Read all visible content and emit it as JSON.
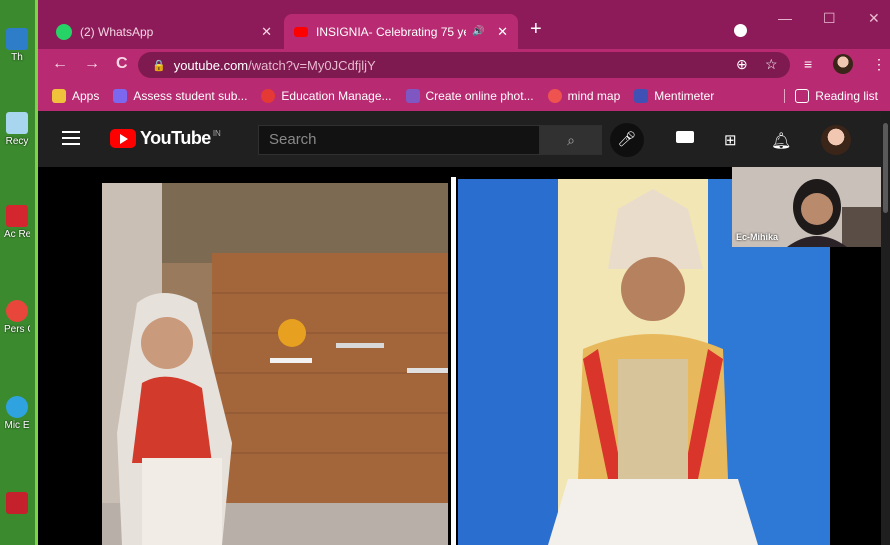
{
  "desktop": {
    "icons": [
      {
        "label": "Th",
        "name": "this-pc-icon",
        "color": "#2e7dc8"
      },
      {
        "label": "Recy",
        "name": "recycle-bin-icon",
        "color": "#a8d6ee"
      },
      {
        "label": "Ac Rea",
        "name": "acrobat-reader-icon",
        "color": "#d3262e"
      },
      {
        "label": "Pers Ch",
        "name": "chrome-person-icon",
        "color": "#e8463a"
      },
      {
        "label": "Mic E",
        "name": "microsoft-edge-icon",
        "color": "#2fa3e0"
      },
      {
        "label": "",
        "name": "shortcut-icon",
        "color": "#c4212d"
      }
    ]
  },
  "browser": {
    "tabs": [
      {
        "title": "(2) WhatsApp",
        "favicon_color": "#25d366",
        "icon": "whatsapp-icon"
      },
      {
        "title": "INSIGNIA- Celebrating 75 ye",
        "favicon_color": "#ff0000",
        "icon": "youtube-icon",
        "audio_icon": "🔊"
      }
    ],
    "close_glyph": "✕",
    "new_tab_glyph": "+",
    "window_controls": {
      "minimize": "—",
      "maximize": "☐",
      "close": "✕"
    },
    "nav": {
      "back": "←",
      "forward": "→",
      "reload": "C"
    },
    "url": {
      "host": "youtube.com",
      "path": "/watch?v=My0JCdfjljY"
    },
    "bookmarks": [
      {
        "label": "Apps",
        "color": "#f0c13a",
        "icon": "apps-grid-icon"
      },
      {
        "label": "Assess student sub...",
        "color": "#7b68ee",
        "icon": "assess-icon"
      },
      {
        "label": "Education Manage...",
        "color": "#e53935",
        "icon": "education-icon"
      },
      {
        "label": "Create online phot...",
        "color": "#7e57c2",
        "icon": "photo-icon"
      },
      {
        "label": "mind map",
        "color": "#ef5350",
        "icon": "mindmap-icon"
      },
      {
        "label": "Mentimeter",
        "color": "#3f51b5",
        "icon": "mentimeter-icon"
      },
      {
        "label": "Reading list",
        "color": "#ffffff",
        "icon": "reading-list-icon"
      }
    ]
  },
  "youtube": {
    "logo_text": "YouTube",
    "country": "IN",
    "search_placeholder": "Search"
  },
  "video": {
    "pip_label": "Ec-Mihika"
  }
}
